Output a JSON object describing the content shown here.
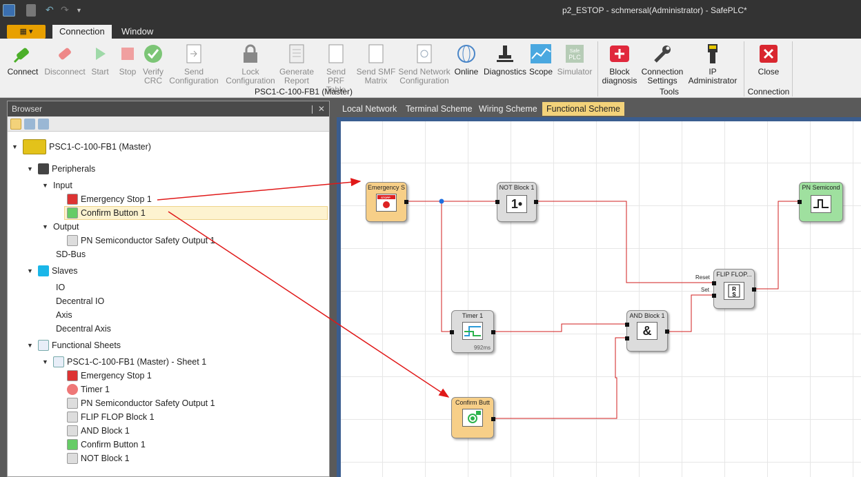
{
  "window": {
    "title": "p2_ESTOP - schmersal(Administrator) - SafePLC*"
  },
  "ribbon_tabs": [
    {
      "label": "Connection"
    },
    {
      "label": "Window"
    }
  ],
  "ribbon": {
    "buttons": [
      {
        "label": "Connect",
        "icon": "plug-connect-icon"
      },
      {
        "label": "Disconnect",
        "icon": "plug-disconnect-icon"
      },
      {
        "label": "Start",
        "icon": "play-icon"
      },
      {
        "label": "Stop",
        "icon": "stop-icon"
      },
      {
        "label": "Verify CRC",
        "icon": "check-icon"
      },
      {
        "label": "Send Configuration",
        "icon": "send-doc-icon"
      },
      {
        "label": "Lock Configuration",
        "icon": "lock-icon"
      },
      {
        "label": "Generate Report",
        "icon": "report-icon"
      },
      {
        "label": "Send PRF Table",
        "icon": "prf-icon"
      },
      {
        "label": "Send SMF Matrix",
        "icon": "smf-icon"
      },
      {
        "label": "Send Network Configuration",
        "icon": "network-doc-icon"
      },
      {
        "label": "Online",
        "icon": "online-icon"
      },
      {
        "label": "Diagnostics",
        "icon": "diagnostics-icon"
      },
      {
        "label": "Scope",
        "icon": "scope-icon"
      },
      {
        "label": "Simulator",
        "icon": "simulator-icon"
      },
      {
        "label": "Block diagnosis",
        "icon": "block-diagnosis-icon"
      },
      {
        "label": "Connection Settings",
        "icon": "wrench-icon"
      },
      {
        "label": "IP Administrator",
        "icon": "ethernet-icon"
      },
      {
        "label": "Close",
        "icon": "close-icon"
      }
    ],
    "groups": {
      "device": "PSC1-C-100-FB1 (Master)",
      "tools": "Tools",
      "connection": "Connection"
    }
  },
  "browser": {
    "title": "Browser",
    "tree": {
      "root": "PSC1-C-100-FB1 (Master)",
      "peripherals": "Peripherals",
      "input": "Input",
      "emergency_stop": "Emergency Stop 1",
      "confirm_button": "Confirm Button 1",
      "output": "Output",
      "pn_output": "PN Semiconductor Safety Output 1",
      "sdbus": "SD-Bus",
      "slaves": "Slaves",
      "io": "IO",
      "decentral_io": "Decentral IO",
      "axis": "Axis",
      "decentral_axis": "Decentral Axis",
      "functional_sheets": "Functional Sheets",
      "sheet": "PSC1-C-100-FB1 (Master) - Sheet 1",
      "sheet_items": [
        "Emergency Stop 1",
        "Timer 1",
        "PN Semiconductor Safety Output 1",
        "FLIP FLOP Block 1",
        "AND Block 1",
        "Confirm Button 1",
        "NOT Block 1"
      ]
    }
  },
  "doc_tabs": [
    {
      "label": "Local Network"
    },
    {
      "label": "Terminal Scheme"
    },
    {
      "label": "Wiring Scheme"
    },
    {
      "label": "Functional Scheme"
    }
  ],
  "blocks": {
    "estop": {
      "title": "Emergency S",
      "badge": "STOPP"
    },
    "not": {
      "title": "NOT Block 1",
      "symbol": "1•"
    },
    "pn": {
      "title": "PN Semicond"
    },
    "flipflop": {
      "title": "FLIP FLOP...",
      "reset": "Reset",
      "set": "Set"
    },
    "and": {
      "title": "AND Block 1",
      "symbol": "&"
    },
    "timer": {
      "title": "Timer 1",
      "value": "992ms"
    },
    "confirm": {
      "title": "Confirm Butt"
    }
  },
  "colors": {
    "input_block": "#f7cf88",
    "output_block": "#9fe09f",
    "logic_block": "#dcdcdc",
    "wire": "#d21e1e",
    "accent": "#e8a000",
    "active_tab": "#f3d27a"
  }
}
